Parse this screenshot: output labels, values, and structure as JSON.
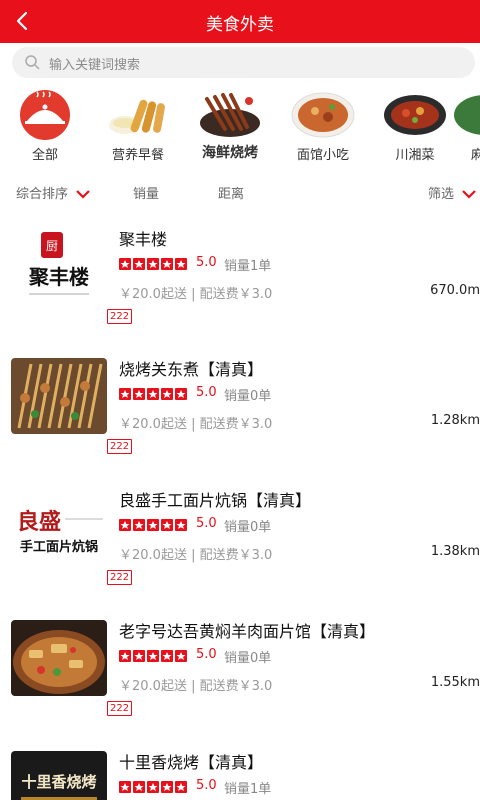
{
  "header": {
    "title": "美食外卖",
    "back_icon": "back-arrow-icon",
    "background": "#e8101a"
  },
  "search": {
    "placeholder": "输入关键词搜索",
    "icon": "search-icon"
  },
  "categories": [
    {
      "label": "全部",
      "icon": "cloche-icon"
    },
    {
      "label": "营养早餐",
      "icon": "breakfast-icon"
    },
    {
      "label": "海鲜烧烤",
      "icon": "bbq-skewers-icon"
    },
    {
      "label": "面馆小吃",
      "icon": "noodle-bowl-icon"
    },
    {
      "label": "川湘菜",
      "icon": "sichuan-dish-icon"
    },
    {
      "label": "麻",
      "icon": "partial-category-icon"
    }
  ],
  "sort": {
    "comprehensive": "综合排序",
    "sales": "销量",
    "distance": "距离",
    "filter": "筛选"
  },
  "shops": [
    {
      "name": "聚丰楼",
      "logo_text": "聚丰楼",
      "rating": "5.0",
      "sales": "销量1单",
      "fees": "￥20.0起送 | 配送费￥3.0",
      "distance": "670.0m",
      "tag": "222"
    },
    {
      "name": "烧烤关东煮【清真】",
      "rating": "5.0",
      "sales": "销量0单",
      "fees": "￥20.0起送 | 配送费￥3.0",
      "distance": "1.28km",
      "tag": "222"
    },
    {
      "name": "良盛手工面片炕锅【清真】",
      "logo_text_top": "良盛",
      "logo_text_bottom": "手工面片炕锅",
      "rating": "5.0",
      "sales": "销量0单",
      "fees": "￥20.0起送 | 配送费￥3.0",
      "distance": "1.38km",
      "tag": "222"
    },
    {
      "name": "老字号达吾黄焖羊肉面片馆【清真】",
      "rating": "5.0",
      "sales": "销量0单",
      "fees": "￥20.0起送 | 配送费￥3.0",
      "distance": "1.55km",
      "tag": "222"
    },
    {
      "name": "十里香烧烤【清真】",
      "logo_text": "十里香烧烤",
      "rating": "5.0",
      "sales": "销量1单"
    }
  ],
  "colors": {
    "accent": "#e8101a",
    "secondary_text": "#999999"
  }
}
